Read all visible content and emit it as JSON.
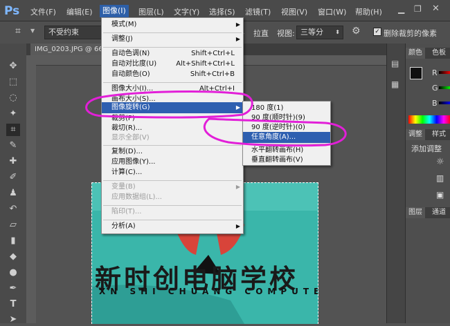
{
  "menubar": {
    "logo": "Ps",
    "items": [
      "文件(F)",
      "编辑(E)",
      "图像(I)",
      "图层(L)",
      "文字(Y)",
      "选择(S)",
      "滤镜(T)",
      "视图(V)",
      "窗口(W)",
      "帮助(H)"
    ]
  },
  "optbar": {
    "ratio_value": "不受约束",
    "straighten_label": "拉直",
    "view_label": "视图:",
    "view_value": "三等分",
    "delete_crop_label": "删除裁剪的像素"
  },
  "document": {
    "tab_label": "IMG_0203.JPG @ 66",
    "photo_text": "新时创电脑学校",
    "photo_subtext": "XN SHI CHUANG COMPUTER"
  },
  "image_menu": {
    "items": [
      {
        "label": "模式(M)",
        "shortcut": "",
        "submenu": true,
        "disabled": false
      },
      {
        "label": "调整(J)",
        "shortcut": "",
        "submenu": true,
        "disabled": false
      },
      {
        "label": "自动色调(N)",
        "shortcut": "Shift+Ctrl+L",
        "submenu": false,
        "disabled": false
      },
      {
        "label": "自动对比度(U)",
        "shortcut": "Alt+Shift+Ctrl+L",
        "submenu": false,
        "disabled": false
      },
      {
        "label": "自动颜色(O)",
        "shortcut": "Shift+Ctrl+B",
        "submenu": false,
        "disabled": false
      },
      {
        "label": "图像大小(I)...",
        "shortcut": "Alt+Ctrl+I",
        "submenu": false,
        "disabled": false
      },
      {
        "label": "画布大小(S)...",
        "shortcut": "",
        "submenu": false,
        "disabled": false
      },
      {
        "label": "图像旋转(G)",
        "shortcut": "",
        "submenu": true,
        "disabled": false
      },
      {
        "label": "裁剪(P)",
        "shortcut": "",
        "submenu": false,
        "disabled": false
      },
      {
        "label": "裁切(R)...",
        "shortcut": "",
        "submenu": false,
        "disabled": false
      },
      {
        "label": "显示全部(V)",
        "shortcut": "",
        "submenu": false,
        "disabled": true
      },
      {
        "label": "复制(D)...",
        "shortcut": "",
        "submenu": false,
        "disabled": false
      },
      {
        "label": "应用图像(Y)...",
        "shortcut": "",
        "submenu": false,
        "disabled": false
      },
      {
        "label": "计算(C)...",
        "shortcut": "",
        "submenu": false,
        "disabled": false
      },
      {
        "label": "变量(B)",
        "shortcut": "",
        "submenu": true,
        "disabled": true
      },
      {
        "label": "应用数据组(L)...",
        "shortcut": "",
        "submenu": false,
        "disabled": true
      },
      {
        "label": "陷印(T)...",
        "shortcut": "",
        "submenu": false,
        "disabled": true
      },
      {
        "label": "分析(A)",
        "shortcut": "",
        "submenu": true,
        "disabled": false
      }
    ]
  },
  "rotate_submenu": {
    "items": [
      {
        "label": "180 度(1)"
      },
      {
        "label": "90 度(顺时针)(9)"
      },
      {
        "label": "90 度(逆时针)(0)"
      },
      {
        "label": "任意角度(A)..."
      },
      {
        "label": "水平翻转画布(H)"
      },
      {
        "label": "垂直翻转画布(V)"
      }
    ]
  },
  "right_panel": {
    "color_tab": "颜色",
    "swatch_tab": "色板",
    "channel_r": "R",
    "channel_g": "G",
    "channel_b": "B",
    "adjust_tab": "调整",
    "style_tab": "样式",
    "add_adjust_label": "添加调整",
    "layers_tab": "图层",
    "channels_tab": "通道"
  },
  "colors": {
    "highlight": "#2e5fb0",
    "annotation": "#e21fd8",
    "photo_bg": "#38b3a8"
  }
}
